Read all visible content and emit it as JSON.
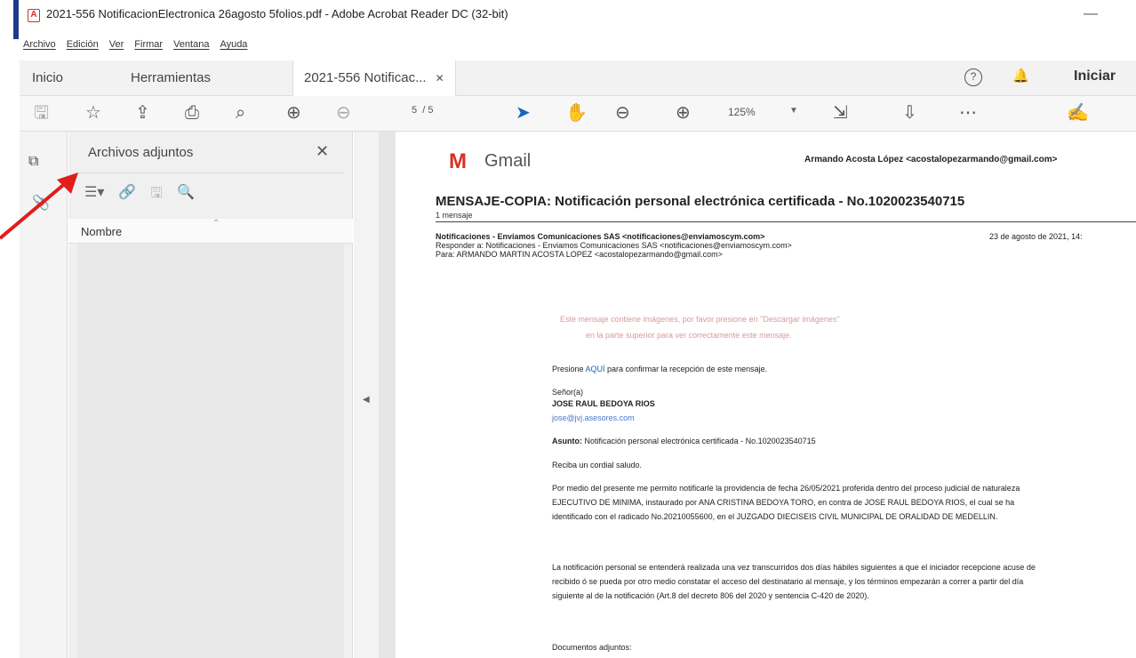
{
  "window": {
    "title": "2021-556 NotificacionElectronica 26agosto 5folios.pdf - Adobe Acrobat Reader DC (32-bit)",
    "minimize_glyph": "—"
  },
  "menu": [
    "Archivo",
    "Edición",
    "Ver",
    "Firmar",
    "Ventana",
    "Ayuda"
  ],
  "tabs": {
    "home": "Inicio",
    "tools": "Herramientas",
    "document": "2021-556 Notificac...",
    "close_glyph": "✕",
    "login": "Iniciar"
  },
  "toolbar": {
    "page_current": "5",
    "page_total": "/ 5",
    "zoom": "125%"
  },
  "attachments_panel": {
    "title": "Archivos adjuntos",
    "column_name": "Nombre"
  },
  "document": {
    "gmail_label": "Gmail",
    "sender_top": "Armando Acosta López <acostalopezarmando@gmail.com>",
    "subject": "MENSAJE-COPIA: Notificación personal electrónica certificada - No.1020023540715",
    "message_count": "1 mensaje",
    "from_line": "Notificaciones - Enviamos Comunicaciones SAS <notificaciones@enviamoscym.com>",
    "date": "23 de agosto de 2021, 14:",
    "reply_to": "Responder a: Notificaciones - Enviamos Comunicaciones SAS <notificaciones@enviamoscym.com>",
    "to": "Para: ARMANDO MARTIN ACOSTA LOPEZ <acostalopezarmando@gmail.com>",
    "images_notice_1": "Este mensaje contiene imágenes, por favor presione en \"Descargar imágenes\"",
    "images_notice_2": "en la parte superior para ver correctamente este mensaje.",
    "confirm_before": "Presione ",
    "confirm_link": "AQUÍ",
    "confirm_after": " para confirmar la recepción de este mensaje.",
    "salutation": "Señor(a)",
    "recipient": "JOSE RAUL BEDOYA RIOS",
    "recipient_email": "jose@jvj.asesores.com",
    "asunto_label": "Asunto:",
    "asunto_text": " Notificación personal electrónica certificada - No.1020023540715",
    "greeting": "Reciba un cordial saludo.",
    "paragraph1": "Por medio del presente me permito notificarle la providencia de fecha 26/05/2021 proferida dentro del proceso judicial de naturaleza EJECUTIVO DE MINIMA, instaurado por ANA CRISTINA BEDOYA TORO, en contra de JOSE RAUL BEDOYA RIOS, el cual se ha identificado con el radicado No.20210055600, en el JUZGADO DIECISEIS CIVIL MUNICIPAL DE ORALIDAD DE MEDELLIN.",
    "paragraph2": "La notificación personal se entenderá realizada una vez transcurridos dos días hábiles siguientes a que el iniciador recepcione acuse de recibido ó se pueda por otro medio constatar el acceso del destinatario al mensaje, y los términos empezarán a correr a partir del día siguiente al de la notificación (Art.8 del decreto 806 del 2020 y sentencia C-420 de 2020).",
    "attachments_heading": "Documentos adjuntos:"
  },
  "colors": {
    "accent_blue": "#1565c0",
    "gmail_red": "#d93025",
    "annotation_red": "#e11d1d"
  }
}
